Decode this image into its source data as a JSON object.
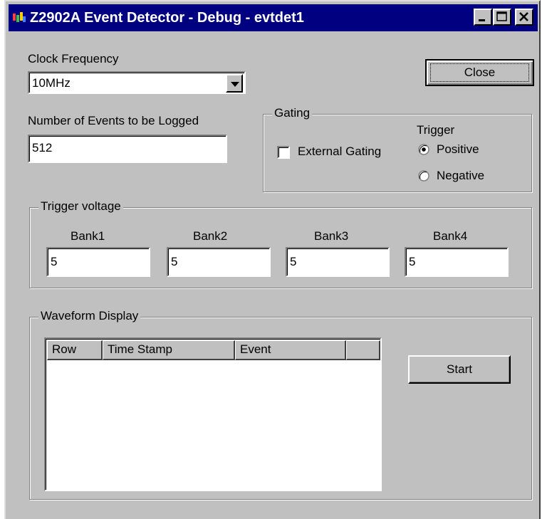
{
  "window": {
    "title": "Z2902A Event Detector - Debug - evtdet1",
    "controls": {
      "minimize": "minimize-icon",
      "maximize": "maximize-icon",
      "close": "close-icon"
    }
  },
  "clock": {
    "label": "Clock Frequency",
    "selected": "10MHz"
  },
  "events": {
    "label": "Number of Events to be Logged",
    "value": "512"
  },
  "close_button": "Close",
  "gating": {
    "title": "Gating",
    "external_label": "External Gating",
    "external_checked": false,
    "trigger_label": "Trigger",
    "positive_label": "Positive",
    "negative_label": "Negative",
    "selected": "Positive"
  },
  "trigger_voltage": {
    "title": "Trigger voltage",
    "banks": [
      {
        "label": "Bank1",
        "value": "5"
      },
      {
        "label": "Bank2",
        "value": "5"
      },
      {
        "label": "Bank3",
        "value": "5"
      },
      {
        "label": "Bank4",
        "value": "5"
      }
    ]
  },
  "waveform": {
    "title": "Waveform Display",
    "columns": [
      "Row",
      "Time Stamp",
      "Event",
      ""
    ],
    "rows": [],
    "start_button": "Start"
  },
  "colors": {
    "titlebar": "#000080",
    "face": "#c0c0c0",
    "field": "#ffffff"
  }
}
